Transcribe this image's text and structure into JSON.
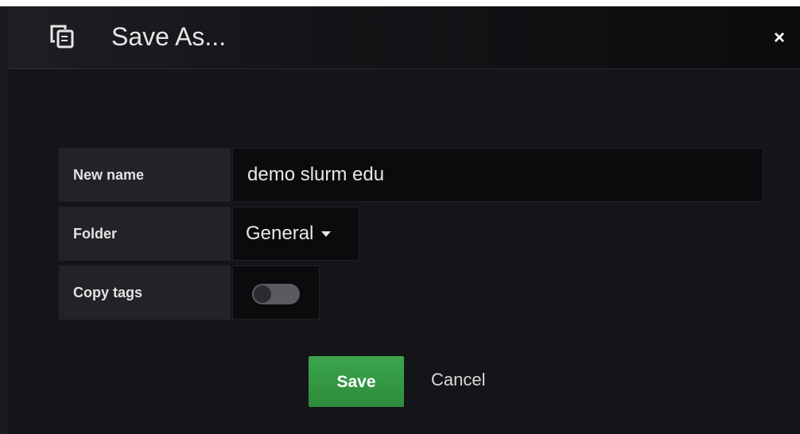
{
  "modal": {
    "title": "Save As...",
    "icon": "copy-icon",
    "close_label": "×"
  },
  "form": {
    "name": {
      "label": "New name",
      "value": "demo slurm edu"
    },
    "folder": {
      "label": "Folder",
      "selected": "General"
    },
    "copy_tags": {
      "label": "Copy tags",
      "enabled": false
    }
  },
  "actions": {
    "save_label": "Save",
    "cancel_label": "Cancel"
  },
  "colors": {
    "background": "#141518",
    "save_button": "#35994a",
    "label_bg": "#222327",
    "input_bg": "#0b0b0d"
  }
}
